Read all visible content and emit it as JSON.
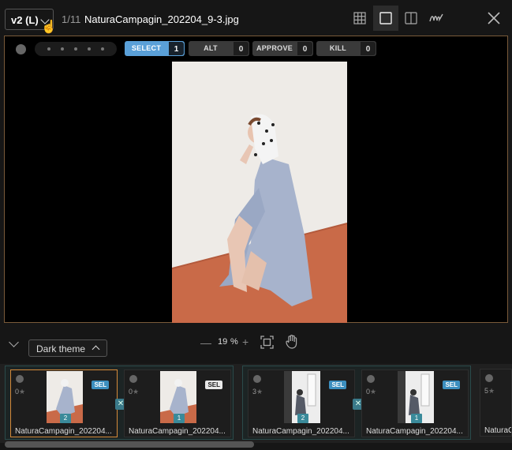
{
  "header": {
    "version_label": "v2 (L)",
    "counter": "1/11",
    "filename": "NaturaCampagin_202204_9-3.jpg",
    "view_modes": [
      "grid-icon",
      "single-icon",
      "compare-icon",
      "signature-icon"
    ],
    "active_view": "single-icon"
  },
  "toolbar": {
    "labels": [
      {
        "label": "SELECT",
        "count": "1",
        "active": true
      },
      {
        "label": "ALT",
        "count": "0",
        "active": false
      },
      {
        "label": "APPROVE",
        "count": "0",
        "active": false
      },
      {
        "label": "KILL",
        "count": "0",
        "active": false
      }
    ],
    "rating_dots": 5
  },
  "bottom": {
    "theme_label": "Dark theme",
    "zoom_value": "19",
    "zoom_unit": "%"
  },
  "filmstrip": {
    "cards": [
      {
        "name": "NaturaCampagin_202204...",
        "rating": "0",
        "tag": "SEL",
        "version": "2"
      },
      {
        "name": "NaturaCampagin_202204...",
        "rating": "0",
        "tag": "SEL",
        "version": "1"
      },
      {
        "name": "NaturaCampagin_202204...",
        "rating": "3",
        "tag": "SEL",
        "version": "2"
      },
      {
        "name": "NaturaCampagin_202204...",
        "rating": "0",
        "tag": "SEL",
        "version": "1"
      },
      {
        "name": "NaturaCampa",
        "rating": "5",
        "tag": "",
        "version": ""
      }
    ],
    "star": "★",
    "x_badge": "✕"
  },
  "colors": {
    "accent": "#5aa0d8",
    "current_border": "#d58a3a",
    "viewer_border": "#7a5a3a"
  }
}
